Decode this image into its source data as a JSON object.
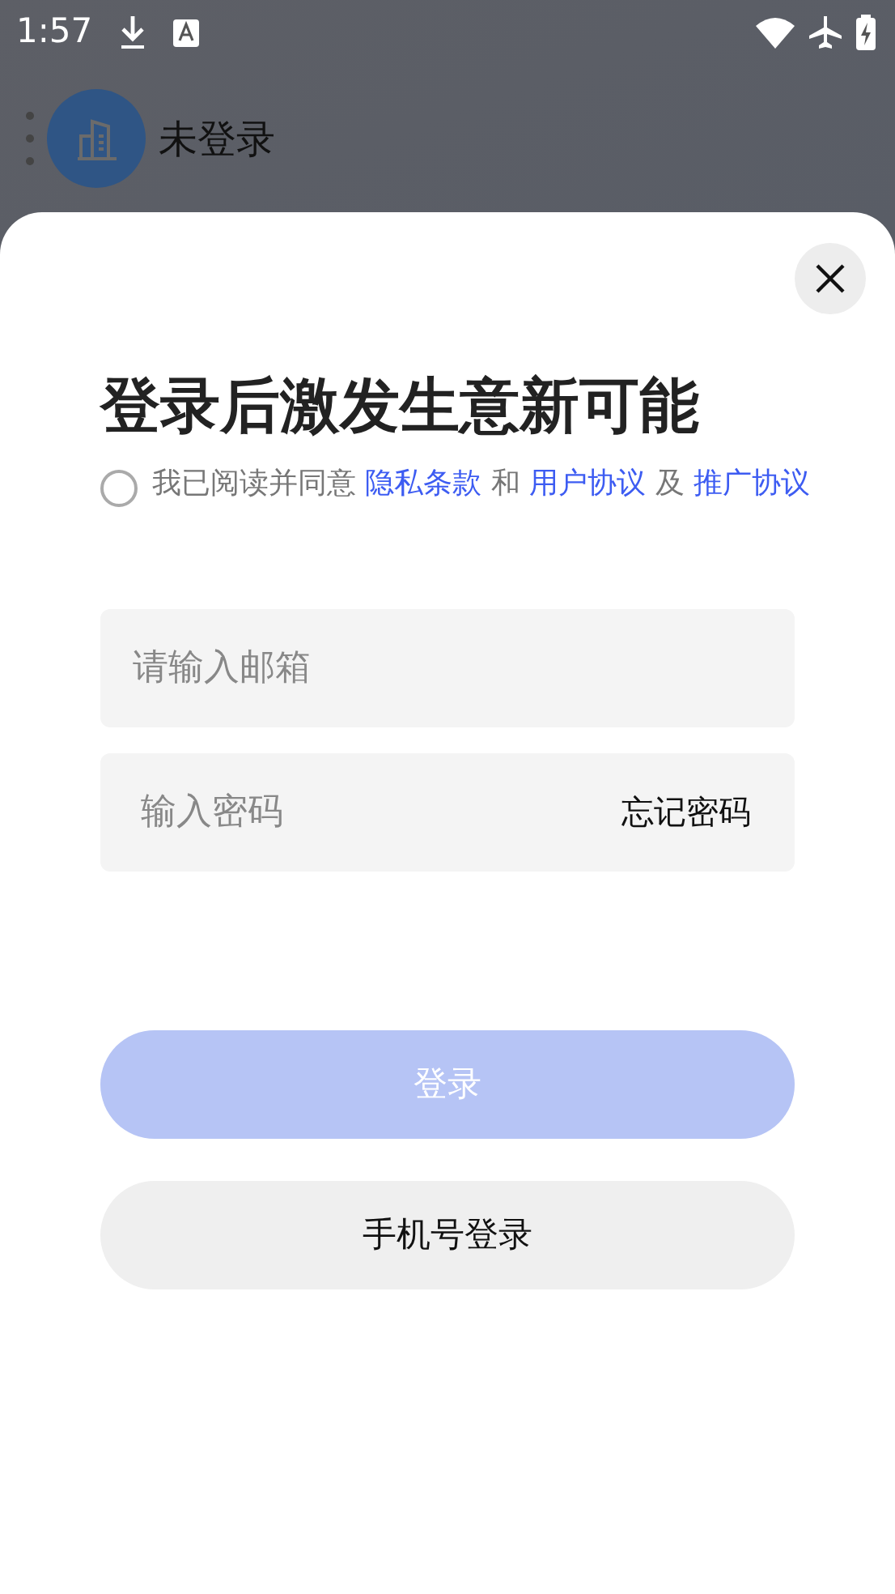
{
  "status_bar": {
    "time": "1:57"
  },
  "header": {
    "title": "未登录"
  },
  "sheet": {
    "title": "登录后激发生意新可能",
    "agreement": {
      "checked": false,
      "parts": [
        {
          "kind": "text",
          "text": "我已阅读并同意 "
        },
        {
          "kind": "link",
          "text": "隐私条款"
        },
        {
          "kind": "text",
          "text": " 和 "
        },
        {
          "kind": "link",
          "text": "用户协议"
        },
        {
          "kind": "text",
          "text": " 及 "
        },
        {
          "kind": "link",
          "text": "推广协议"
        }
      ]
    },
    "email_field": {
      "placeholder": "请输入邮箱"
    },
    "password_field": {
      "placeholder": "输入密码",
      "action": "忘记密码"
    },
    "login_button": {
      "label": "登录",
      "disabled": true
    },
    "phone_login_button": {
      "label": "手机号登录"
    }
  }
}
